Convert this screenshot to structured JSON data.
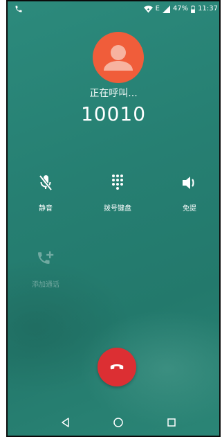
{
  "status_bar": {
    "battery_text": "47%",
    "time": "11:37",
    "network_type": "E",
    "left_icon": "phone-icon",
    "icons": [
      "wifi-icon",
      "signal-icon",
      "battery-icon"
    ]
  },
  "call": {
    "status": "正在呼叫...",
    "number": "10010",
    "avatar_icon": "person-icon",
    "avatar_color": "#f05d3a"
  },
  "controls": [
    {
      "label": "静音",
      "icon": "mic-off-icon"
    },
    {
      "label": "拨号键盘",
      "icon": "dialpad-icon"
    },
    {
      "label": "免提",
      "icon": "speaker-icon"
    }
  ],
  "add_call": {
    "label": "添加通话",
    "icon": "add-call-icon",
    "enabled": false
  },
  "end_call": {
    "icon": "end-call-icon",
    "color": "#dc2f33"
  },
  "nav_bar": {
    "icons": [
      "back-icon",
      "home-icon",
      "recents-icon"
    ]
  },
  "colors": {
    "background": "#267f72",
    "text": "#ffffff"
  }
}
